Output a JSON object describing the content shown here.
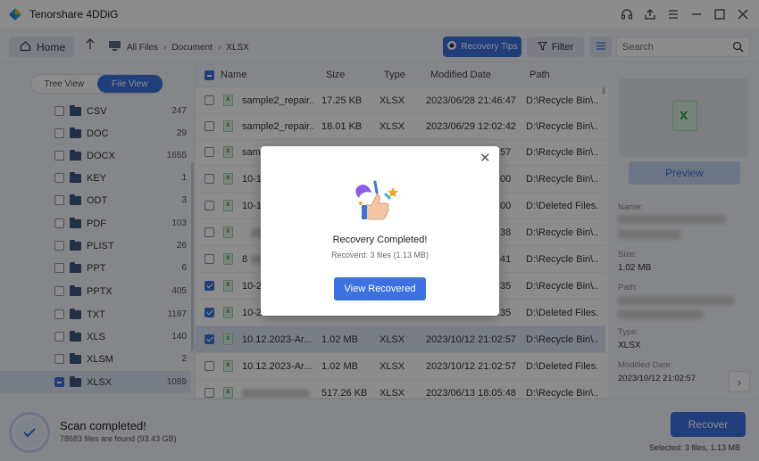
{
  "app": {
    "title": "Tenorshare 4DDiG"
  },
  "window_icons": [
    "headset-icon",
    "upload-icon",
    "menu-icon",
    "minimize-icon",
    "maximize-icon",
    "close-icon"
  ],
  "toolbar": {
    "home_label": "Home",
    "breadcrumbs": [
      "All Files",
      "Document",
      "XLSX"
    ],
    "recovery_tips_label": "Recovery Tips",
    "filter_label": "Filter",
    "search_placeholder": "Search"
  },
  "sidebar": {
    "tabs": [
      "Tree View",
      "File View"
    ],
    "active_tab": "File View",
    "items": [
      {
        "label": "CSV",
        "count": "247"
      },
      {
        "label": "DOC",
        "count": "29"
      },
      {
        "label": "DOCX",
        "count": "1655"
      },
      {
        "label": "KEY",
        "count": "1"
      },
      {
        "label": "ODT",
        "count": "3"
      },
      {
        "label": "PDF",
        "count": "103"
      },
      {
        "label": "PLIST",
        "count": "26"
      },
      {
        "label": "PPT",
        "count": "6"
      },
      {
        "label": "PPTX",
        "count": "405"
      },
      {
        "label": "TXT",
        "count": "1187"
      },
      {
        "label": "XLS",
        "count": "140"
      },
      {
        "label": "XLSM",
        "count": "2"
      },
      {
        "label": "XLSX",
        "count": "1089"
      }
    ]
  },
  "table": {
    "headers": {
      "name": "Name",
      "size": "Size",
      "type": "Type",
      "modified": "Modified Date",
      "path": "Path"
    },
    "rows": [
      {
        "name": "sample2_repair...",
        "size": "17.25 KB",
        "type": "XLSX",
        "modified": "2023/06/28 21:46:47",
        "path": "D:\\Recycle Bin\\...",
        "checked": false
      },
      {
        "name": "sample2_repair...",
        "size": "18.01 KB",
        "type": "XLSX",
        "modified": "2023/06/29 12:02:42",
        "path": "D:\\Recycle Bin\\...",
        "checked": false
      },
      {
        "name": "sam",
        "size": "",
        "type": "",
        "modified": ":57",
        "path": "D:\\Recycle Bin\\...",
        "checked": false
      },
      {
        "name": "10-1",
        "size": "",
        "type": "",
        "modified": ":00",
        "path": "D:\\Recycle Bin\\...",
        "checked": false
      },
      {
        "name": "10-1",
        "size": "",
        "type": "",
        "modified": ":00",
        "path": "D:\\Deleted Files...",
        "checked": false
      },
      {
        "name": "",
        "size": "",
        "type": "",
        "modified": ":38",
        "path": "D:\\Recycle Bin\\...",
        "checked": false
      },
      {
        "name": "8",
        "size": "",
        "type": "",
        "modified": ":41",
        "path": "D:\\Recycle Bin\\...",
        "checked": false
      },
      {
        "name": "10-2",
        "size": "",
        "type": "",
        "modified": ":35",
        "path": "D:\\Recycle Bin\\...",
        "checked": true
      },
      {
        "name": "10-2",
        "size": "",
        "type": "",
        "modified": ":35",
        "path": "D:\\Deleted Files...",
        "checked": true
      },
      {
        "name": "10.12.2023-Ar...",
        "size": "1.02 MB",
        "type": "XLSX",
        "modified": "2023/10/12 21:02:57",
        "path": "D:\\Recycle Bin\\...",
        "checked": true
      },
      {
        "name": "10.12.2023-Ar...",
        "size": "1.02 MB",
        "type": "XLSX",
        "modified": "2023/10/12 21:02:57",
        "path": "D:\\Deleted Files...",
        "checked": false
      },
      {
        "name": "",
        "size": "517.26 KB",
        "type": "XLSX",
        "modified": "2023/06/13 18:05:48",
        "path": "D:\\Recycle Bin\\...",
        "checked": false
      }
    ]
  },
  "details": {
    "preview_label": "Preview",
    "name_label": "Name:",
    "size_label": "Size:",
    "size_value": "1.02 MB",
    "path_label": "Path:",
    "type_label": "Type:",
    "type_value": "XLSX",
    "modified_label": "Modified Date:",
    "modified_value": "2023/10/12 21:02:57"
  },
  "footer": {
    "scan_title": "Scan completed!",
    "scan_sub": "78683 files are found (93.43 GB)",
    "recover_label": "Recover",
    "selected_info": "Selected: 3 files, 1.13 MB"
  },
  "modal": {
    "title": "Recovery Completed!",
    "subtitle": "Recoverd: 3 files (1.13 MB)",
    "button_label": "View Recovered"
  },
  "colors": {
    "accent": "#3b71e0",
    "excel_green": "#27a050"
  }
}
